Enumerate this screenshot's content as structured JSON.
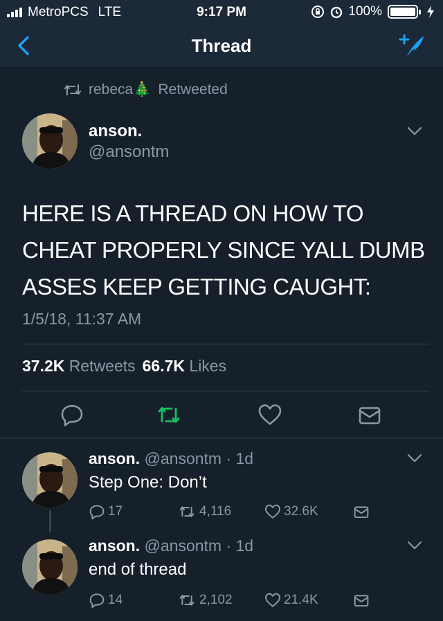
{
  "status_bar": {
    "carrier": "MetroPCS",
    "network": "LTE",
    "time": "9:17 PM",
    "battery": "100%"
  },
  "nav": {
    "title": "Thread"
  },
  "retweet_header": {
    "user": "rebeca🎄",
    "label": "Retweeted"
  },
  "main_tweet": {
    "name": "anson.",
    "handle": "@ansontm",
    "lines": [
      "HERE IS A THREAD ON HOW TO",
      "CHEAT PROPERLY SINCE YALL DUMB",
      "ASSES KEEP GETTING CAUGHT:"
    ],
    "timestamp": "1/5/18, 11:37 AM",
    "retweet_count": "37.2K",
    "retweet_label": "Retweets",
    "like_count": "66.7K",
    "like_label": "Likes"
  },
  "replies": [
    {
      "name": "anson.",
      "meta": "@ansontm · 1d",
      "text": "Step One: Don’t",
      "replies": "17",
      "retweets": "4,116",
      "likes": "32.6K"
    },
    {
      "name": "anson.",
      "meta": "@ansontm · 1d",
      "text": "end of thread",
      "replies": "14",
      "retweets": "2,102",
      "likes": "21.4K"
    }
  ],
  "colors": {
    "background": "#15202b",
    "bar": "#1c2938",
    "accent": "#1da1f2",
    "retweet_active": "#17bf63",
    "secondary_text": "#8899a6"
  }
}
